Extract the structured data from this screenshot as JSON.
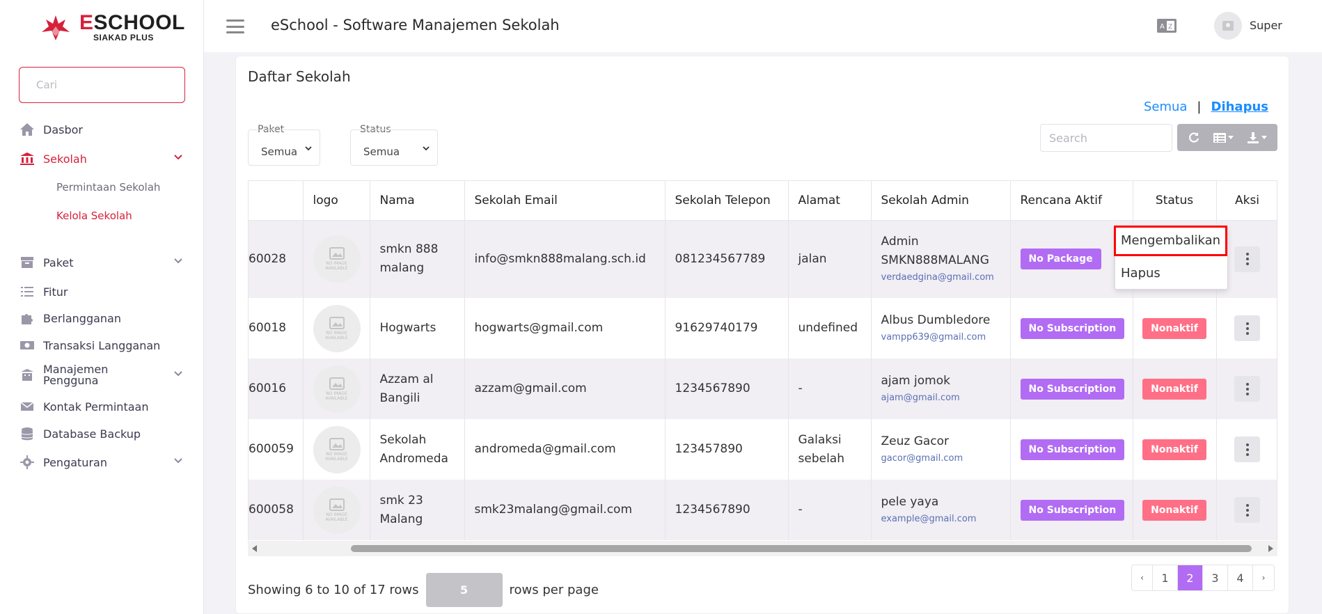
{
  "brand": {
    "title_accent": "E",
    "title_rest": "SCHOOL",
    "subtitle": "SIAKAD PLUS"
  },
  "sidebar": {
    "search_placeholder": "Cari",
    "items": [
      {
        "label": "Dasbor",
        "icon": "home-icon"
      },
      {
        "label": "Sekolah",
        "icon": "bank-icon"
      },
      {
        "label": "Permintaan Sekolah"
      },
      {
        "label": "Kelola Sekolah"
      },
      {
        "label": "Paket",
        "icon": "archive-icon"
      },
      {
        "label": "Fitur",
        "icon": "list-icon"
      },
      {
        "label": "Berlangganan",
        "icon": "puzzle-icon"
      },
      {
        "label": "Transaksi Langganan",
        "icon": "money-icon"
      },
      {
        "label": "Manajemen Pengguna",
        "icon": "building-icon"
      },
      {
        "label": "Kontak Permintaan",
        "icon": "mail-icon"
      },
      {
        "label": "Database Backup",
        "icon": "database-icon"
      },
      {
        "label": "Pengaturan",
        "icon": "gear-icon"
      }
    ]
  },
  "header": {
    "title": "eSchool - Software Manajemen Sekolah",
    "user": "Super"
  },
  "main": {
    "title": "Daftar Sekolah",
    "filter_all": "Semua",
    "filter_separator": "|",
    "filter_deleted": "Dihapus",
    "paket_label": "Paket",
    "paket_value": "Semua",
    "status_label": "Status",
    "status_value": "Semua",
    "search_placeholder": "Search",
    "columns": [
      "",
      "logo",
      "Nama",
      "Sekolah Email",
      "Sekolah Telepon",
      "Alamat",
      "Sekolah Admin",
      "Rencana Aktif",
      "Status",
      "Aksi"
    ],
    "no_image_text": [
      "NO IMAGE",
      "AVAILABLE"
    ],
    "rows": [
      {
        "id": "60028",
        "name": "smkn 888 malang",
        "email": "info@smkn888malang.sch.id",
        "phone": "081234567789",
        "address": "jalan",
        "admin_name": "Admin SMKN888MALANG",
        "admin_email": "verdaedgina@gmail.com",
        "plan": "No Package",
        "status": ""
      },
      {
        "id": "60018",
        "name": "Hogwarts",
        "email": "hogwarts@gmail.com",
        "phone": "91629740179",
        "address": "undefined",
        "admin_name": "Albus Dumbledore",
        "admin_email": "vampp639@gmail.com",
        "plan": "No Subscription",
        "status": "Nonaktif"
      },
      {
        "id": "60016",
        "name": "Azzam al Bangili",
        "email": "azzam@gmail.com",
        "phone": "1234567890",
        "address": "-",
        "admin_name": "ajam jomok",
        "admin_email": "ajam@gmail.com",
        "plan": "No Subscription",
        "status": "Nonaktif"
      },
      {
        "id": "600059",
        "name": "Sekolah Andromeda",
        "email": "andromeda@gmail.com",
        "phone": "123457890",
        "address": "Galaksi sebelah",
        "admin_name": "Zeuz Gacor",
        "admin_email": "gacor@gmail.com",
        "plan": "No Subscription",
        "status": "Nonaktif"
      },
      {
        "id": "600058",
        "name": "smk 23 Malang",
        "email": "smk23malang@gmail.com",
        "phone": "1234567890",
        "address": "-",
        "admin_name": "pele yaya",
        "admin_email": "example@gmail.com",
        "plan": "No Subscription",
        "status": "Nonaktif"
      }
    ],
    "action_menu": {
      "restore": "Mengembalikan",
      "delete": "Hapus"
    },
    "footer": {
      "showing_text": "Showing 6 to 10 of 17 rows",
      "per_page_value": "5",
      "per_page_label": "rows per page",
      "pages": [
        "‹",
        "1",
        "2",
        "3",
        "4",
        "›"
      ],
      "active_page": "2"
    }
  },
  "colors": {
    "brand": "#d6213b",
    "accent": "#b16cf3",
    "status": "#ff6f86",
    "link": "#1a8cff"
  }
}
